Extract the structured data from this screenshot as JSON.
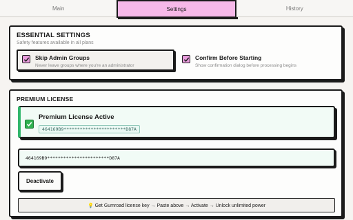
{
  "tabs": [
    {
      "label": "Main",
      "active": false
    },
    {
      "label": "Settings",
      "active": true
    },
    {
      "label": "History",
      "active": false
    }
  ],
  "essential": {
    "title": "ESSENTIAL SETTINGS",
    "subtitle": "Safety features available in all plans",
    "options": [
      {
        "label": "Skip Admin Groups",
        "description": "Never leave groups where you're an administrator",
        "checked": true
      },
      {
        "label": "Confirm Before Starting",
        "description": "Show confirmation dialog before processing begins",
        "checked": true
      }
    ]
  },
  "premium": {
    "title": "PREMIUM LICENSE",
    "status_icon": "check-mark-icon",
    "status_title": "Premium License Active",
    "license_key_masked": "464169B9***********************D87A",
    "input_value": "464169B9***********************D87A",
    "deactivate_label": "Deactivate",
    "hint": "💡 Get Gumroad license key → Paste above → Activate → Unlock unlimited power"
  },
  "colors": {
    "accent_pink": "#f6b8e8",
    "checkbox_pink": "#e99ddd",
    "success_green": "#2fb56a",
    "border": "#1a1a1a"
  }
}
